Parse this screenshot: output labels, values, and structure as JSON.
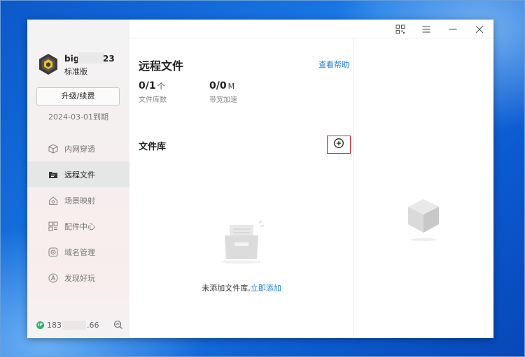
{
  "sidebar": {
    "user_name": "big",
    "user_suffix": "23",
    "plan": "标准版",
    "upgrade_label": "升级/续费",
    "expiry": "2024-03-01到期",
    "items": [
      {
        "label": "内网穿透",
        "icon": "cube-outline-icon",
        "active": false
      },
      {
        "label": "远程文件",
        "icon": "folder-files-icon",
        "active": true
      },
      {
        "label": "场景映射",
        "icon": "house-scene-icon",
        "active": false
      },
      {
        "label": "配件中心",
        "icon": "grid-apps-icon",
        "active": false
      },
      {
        "label": "域名管理",
        "icon": "domain-target-icon",
        "active": false
      },
      {
        "label": "发现好玩",
        "icon": "compass-icon",
        "active": false
      }
    ],
    "ip_badge": "IP",
    "ip_prefix": "183",
    "ip_suffix": ".66"
  },
  "titlebar": {
    "icons": [
      "qr-code-icon",
      "menu-icon",
      "minimize-icon",
      "close-icon"
    ]
  },
  "main": {
    "title": "远程文件",
    "help": "查看帮助",
    "stats": [
      {
        "value": "0/1",
        "unit": "个",
        "label": "文件库数"
      },
      {
        "value": "0/0",
        "unit": "M",
        "label": "带宽加速"
      }
    ],
    "section_title": "文件库",
    "empty_text": "未添加文件库,",
    "empty_link": "立即添加"
  },
  "colors": {
    "accent": "#1f7fd9",
    "highlight_border": "#e02020",
    "ip_badge": "#2fb06a"
  }
}
